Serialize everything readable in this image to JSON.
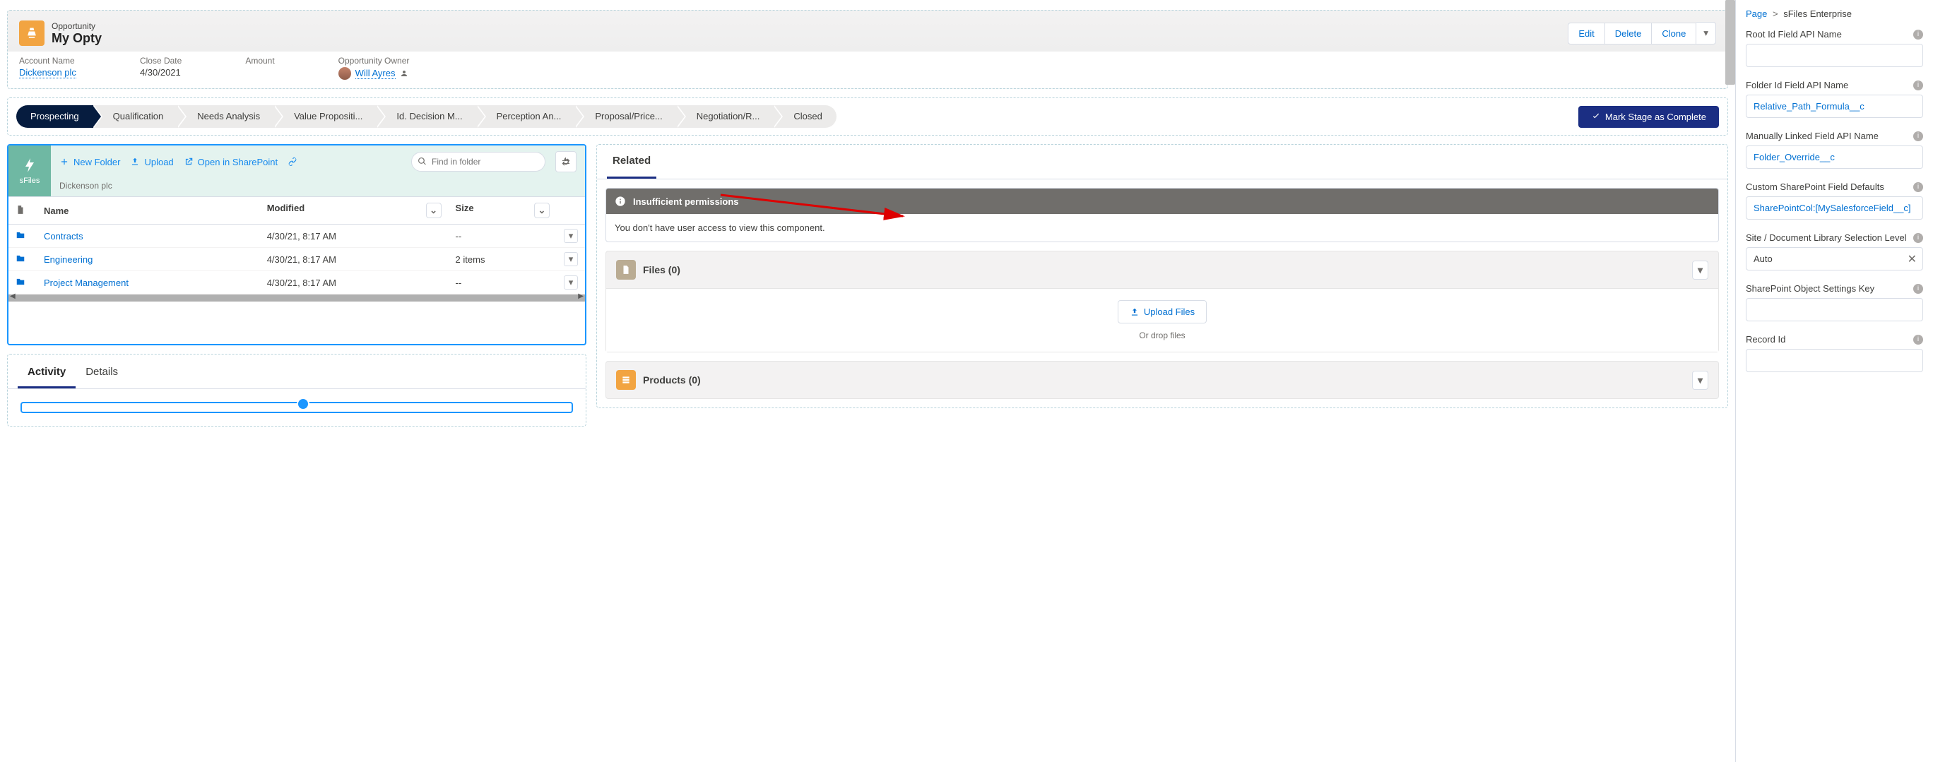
{
  "highlights": {
    "object_label": "Opportunity",
    "record_name": "My Opty",
    "actions": {
      "edit": "Edit",
      "delete": "Delete",
      "clone": "Clone"
    },
    "fields": {
      "account_label": "Account Name",
      "account_value": "Dickenson plc",
      "close_label": "Close Date",
      "close_value": "4/30/2021",
      "amount_label": "Amount",
      "amount_value": "",
      "owner_label": "Opportunity Owner",
      "owner_value": "Will Ayres"
    }
  },
  "path": {
    "stages": [
      "Prospecting",
      "Qualification",
      "Needs Analysis",
      "Value Propositi...",
      "Id. Decision M...",
      "Perception An...",
      "Proposal/Price...",
      "Negotiation/R...",
      "Closed"
    ],
    "mark_label": "Mark Stage as Complete"
  },
  "sfiles": {
    "brand": "sFiles",
    "actions": {
      "new_folder": "New Folder",
      "upload": "Upload",
      "open_sp": "Open in SharePoint"
    },
    "search_placeholder": "Find in folder",
    "breadcrumb": "Dickenson plc",
    "columns": {
      "name": "Name",
      "modified": "Modified",
      "size": "Size"
    },
    "rows": [
      {
        "name": "Contracts",
        "modified": "4/30/21, 8:17 AM",
        "size": "--"
      },
      {
        "name": "Engineering",
        "modified": "4/30/21, 8:17 AM",
        "size": "2 items"
      },
      {
        "name": "Project Management",
        "modified": "4/30/21, 8:17 AM",
        "size": "--"
      }
    ]
  },
  "tabs": {
    "activity": "Activity",
    "details": "Details"
  },
  "related": {
    "tab": "Related",
    "perm_title": "Insufficient permissions",
    "perm_body": "You don't have user access to view this component.",
    "files_title": "Files (0)",
    "upload": "Upload Files",
    "drop": "Or drop files",
    "products_title": "Products (0)"
  },
  "sidebar": {
    "bc_page": "Page",
    "bc_comp": "sFiles Enterprise",
    "props": [
      {
        "label": "Root Id Field API Name",
        "value": "",
        "link": false
      },
      {
        "label": "Folder Id Field API Name",
        "value": "Relative_Path_Formula__c",
        "link": true
      },
      {
        "label": "Manually Linked Field API Name",
        "value": "Folder_Override__c",
        "link": true
      },
      {
        "label": "Custom SharePoint Field Defaults",
        "value": "SharePointCol:[MySalesforceField__c]",
        "link": true
      },
      {
        "label": "Site / Document Library Selection Level",
        "value": "Auto",
        "combo": true
      },
      {
        "label": "SharePoint Object Settings Key",
        "value": "",
        "link": false
      },
      {
        "label": "Record Id",
        "value": "",
        "link": false
      }
    ]
  }
}
